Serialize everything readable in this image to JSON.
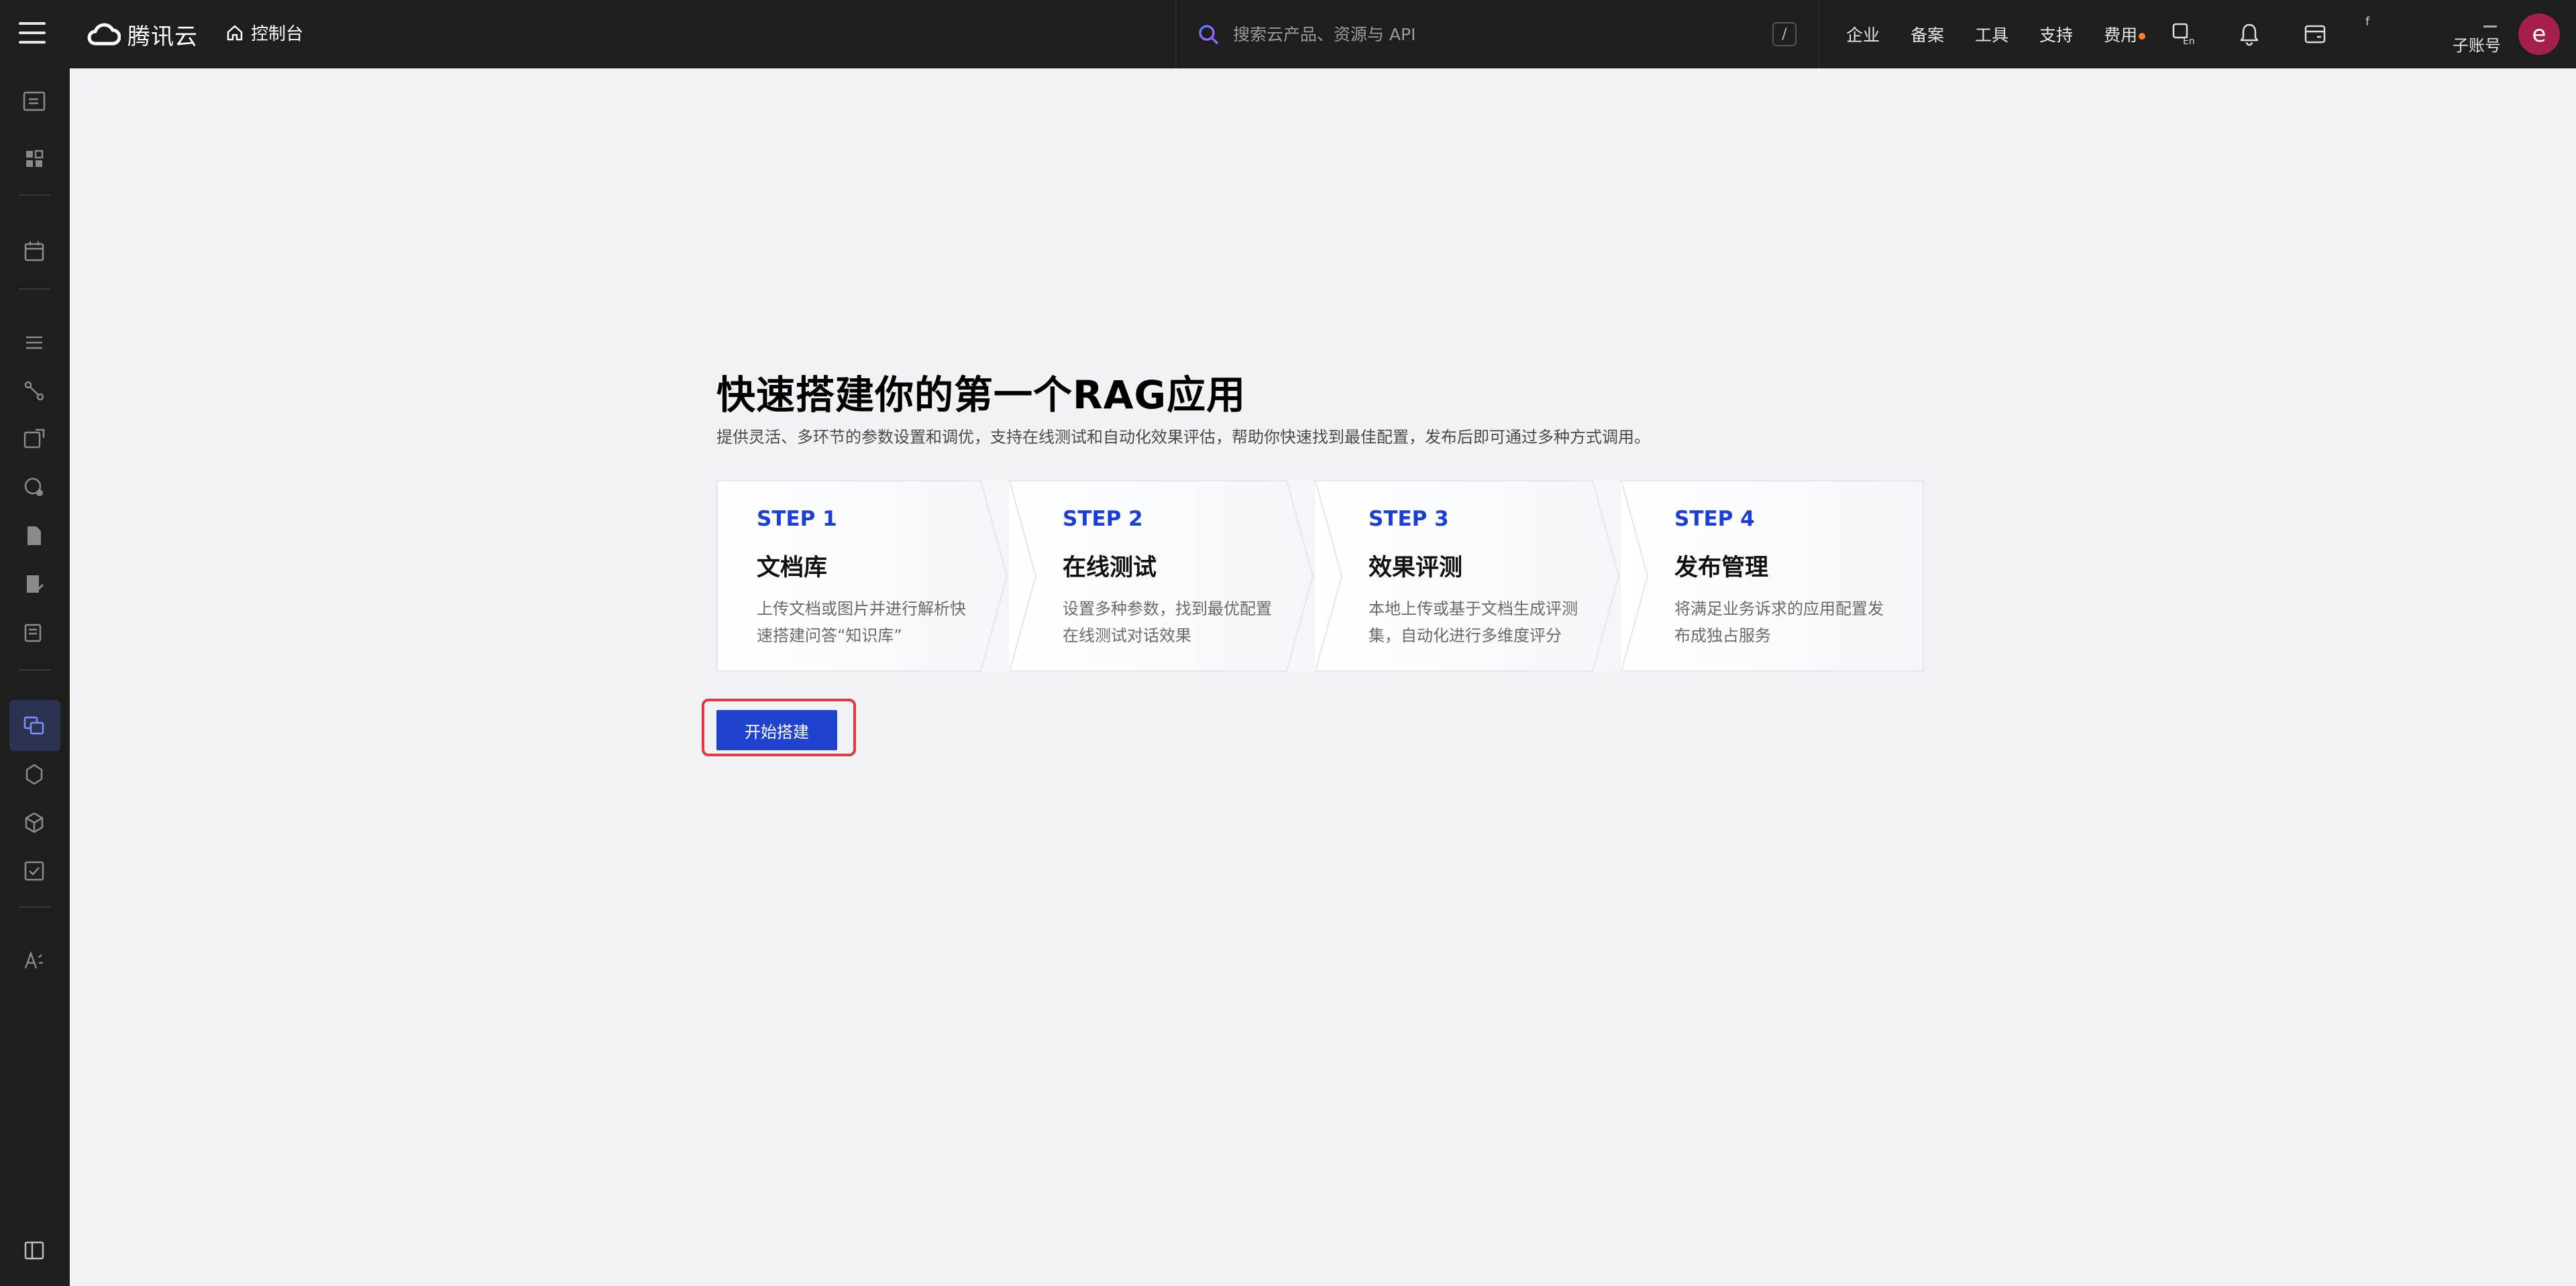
{
  "topbar": {
    "menu_icon": "hamburger-icon",
    "brand": "腾讯云",
    "console_label": "控制台",
    "search": {
      "placeholder": "搜索云产品、资源与 API",
      "shortcut": "/"
    },
    "links": [
      "企业",
      "备案",
      "工具",
      "支持",
      "费用"
    ],
    "user_tag": "f",
    "subaccount_label": "子账号",
    "avatar_letter": "e"
  },
  "hero": {
    "title": "快速搭建你的第一个RAG应用",
    "description": "提供灵活、多环节的参数设置和调优，支持在线测试和自动化效果评估，帮助你快速找到最佳配置，发布后即可通过多种方式调用。"
  },
  "steps": [
    {
      "label": "STEP 1",
      "title": "文档库",
      "desc": "上传文档或图片并进行解析快速搭建问答“知识库”"
    },
    {
      "label": "STEP 2",
      "title": "在线测试",
      "desc": "设置多种参数，找到最优配置在线测试对话效果"
    },
    {
      "label": "STEP 3",
      "title": "效果评测",
      "desc": "本地上传或基于文档生成评测集，自动化进行多维度评分"
    },
    {
      "label": "STEP 4",
      "title": "发布管理",
      "desc": "将满足业务诉求的应用配置发布成独占服务"
    }
  ],
  "start_button": "开始搭建",
  "colors": {
    "accent": "#1f43cf",
    "highlight": "#e0393e",
    "topbar": "#1e1e1f",
    "avatar": "#a51f4e",
    "fee_dot": "#ff7d2e"
  }
}
